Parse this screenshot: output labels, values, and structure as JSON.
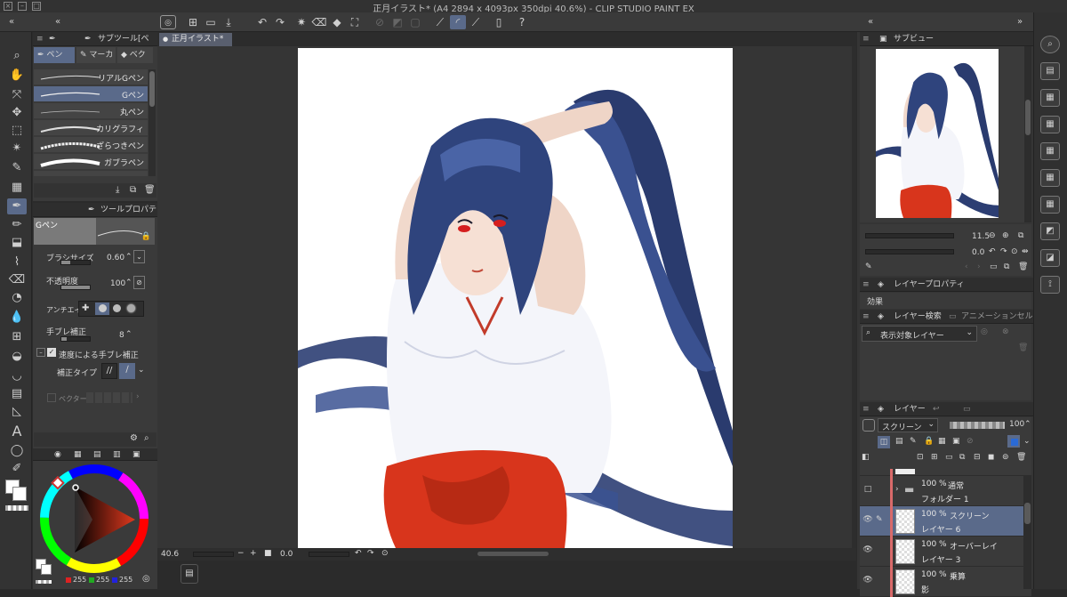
{
  "window": {
    "title": "正月イラスト* (A4 2894 x 4093px 350dpi 40.6%)  - CLIP STUDIO PAINT EX"
  },
  "canvas": {
    "tab_label": "正月イラスト*",
    "zoom": "40.6",
    "rotation": "0.0"
  },
  "sub_tool": {
    "panel_title": "サブツール[ペン]",
    "tabs": [
      "ペン",
      "マーカ",
      "ベクタ"
    ],
    "brushes": [
      "リアルGペン",
      "Gペン",
      "丸ペン",
      "カリグラフィ",
      "ざらつきペン",
      "ガブラペン"
    ]
  },
  "tool_property": {
    "panel_title": "ツールプロパティ[Gペン]",
    "brush_name": "Gペン",
    "brush_size_label": "ブラシサイズ",
    "brush_size_value": "0.60",
    "brush_size_fraction": 0.3,
    "opacity_label": "不透明度",
    "opacity_value": "100",
    "opacity_fraction": 1.0,
    "antialias_label": "アンチエイ",
    "stabilization_label": "手ブレ補正",
    "stabilization_value": "8",
    "speed_stab_label": "速度による手ブレ補正",
    "correction_type_label": "補正タイプ",
    "vector_label": "ベクター"
  },
  "color": {
    "main": "#ffffff",
    "hue_pointer": "#d2341b",
    "r": "255",
    "g": "255",
    "b": "255"
  },
  "navigator": {
    "panel_title": "サブビュー",
    "zoom": "11.5",
    "rotation": "0.0"
  },
  "layer_property": {
    "panel_title": "レイヤープロパティ",
    "effect_label": "効果"
  },
  "layer_search": {
    "panel_title": "レイヤー検索",
    "tab2": "アニメーションセル",
    "dropdown": "表示対象レイヤー"
  },
  "layers": {
    "panel_title": "レイヤー",
    "blend_mode": "スクリーン",
    "opacity": "100",
    "items": [
      {
        "pct": "100 %",
        "mode": "通常",
        "name": "フォルダー 1",
        "selected": false,
        "folder": true
      },
      {
        "pct": "100 %",
        "mode": "スクリーン",
        "name": "レイヤー 6",
        "selected": true,
        "folder": false
      },
      {
        "pct": "100 %",
        "mode": "オーバーレイ",
        "name": "レイヤー 3",
        "selected": false,
        "folder": false
      },
      {
        "pct": "100 %",
        "mode": "乗算",
        "name": "影",
        "selected": false,
        "folder": false
      }
    ]
  }
}
